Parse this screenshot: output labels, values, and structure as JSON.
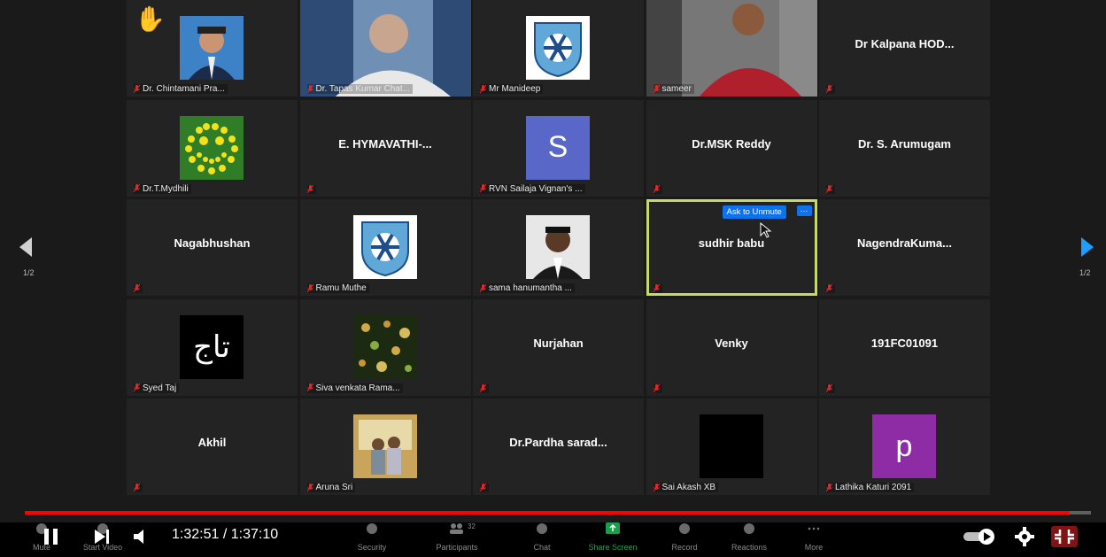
{
  "page_indicator": "1/2",
  "ask_to_unmute": "Ask to Unmute",
  "more_dots": "···",
  "tiles": [
    {
      "name": "Dr. Chintamani Pra...",
      "type": "photo-man"
    },
    {
      "name": "Dr. Tapas Kumar Chat...",
      "type": "video"
    },
    {
      "name": "Mr Manideep",
      "type": "logo"
    },
    {
      "name": "sameer",
      "type": "video-woman"
    },
    {
      "name": "Dr Kalpana HOD...",
      "type": "text"
    },
    {
      "name": "Dr.T.Mydhili",
      "type": "smiley"
    },
    {
      "name": "E. HYMAVATHI-...",
      "type": "text"
    },
    {
      "name": "RVN Sailaja Vignan's ...",
      "type": "letter-s"
    },
    {
      "name": "Dr.MSK Reddy",
      "type": "text"
    },
    {
      "name": "Dr. S. Arumugam",
      "type": "text"
    },
    {
      "name": "Nagabhushan",
      "type": "text"
    },
    {
      "name": "Ramu Muthe",
      "type": "logo"
    },
    {
      "name": "sama hanumantha ...",
      "type": "photo-man2"
    },
    {
      "name": "sudhir babu",
      "type": "text-active"
    },
    {
      "name": "NagendraKuma...",
      "type": "text"
    },
    {
      "name": "Syed Taj",
      "type": "taj"
    },
    {
      "name": "Siva venkata Rama...",
      "type": "bokeh"
    },
    {
      "name": "Nurjahan",
      "type": "text"
    },
    {
      "name": "Venky",
      "type": "text"
    },
    {
      "name": "191FC01091",
      "type": "text"
    },
    {
      "name": "Akhil",
      "type": "text"
    },
    {
      "name": "Aruna Sri",
      "type": "photo-couple"
    },
    {
      "name": "Dr.Pardha sarad...",
      "type": "text"
    },
    {
      "name": "Sai Akash XB",
      "type": "black"
    },
    {
      "name": "Lathika Katuri 2091",
      "type": "letter-p"
    }
  ],
  "letters": {
    "s": "S",
    "p": "p",
    "taj": "تاج"
  },
  "player": {
    "time_current": "1:32:51",
    "time_separator": " / ",
    "time_total": "1:37:10",
    "progress_fraction": 0.98
  },
  "zoom_toolbar": {
    "items": [
      "Mute",
      "Start Video",
      "Security",
      "Participants",
      "Chat",
      "Share Screen",
      "Record",
      "Reactions",
      "More"
    ],
    "participant_count": "32"
  },
  "colors": {
    "accent_blue": "#0e72ed",
    "active_border": "#c6d96a",
    "progress": "#ff0000",
    "share_green": "#22c55e"
  }
}
